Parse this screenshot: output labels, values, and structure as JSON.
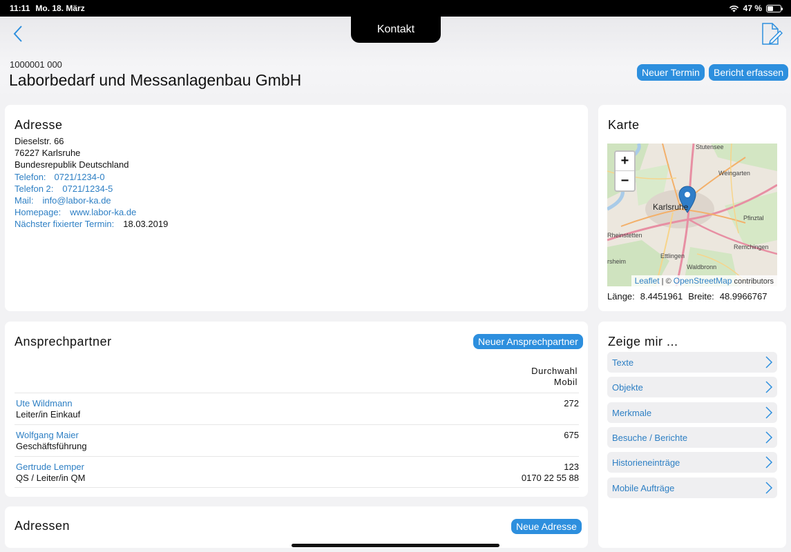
{
  "status": {
    "time": "11:11",
    "date": "Mo. 18. März",
    "battery": "47 %",
    "battery_level": 0.47
  },
  "header": {
    "title": "Kontakt",
    "customer_number": "1000001 000",
    "company_name": "Laborbedarf und Messanlagenbau GmbH",
    "btn_new_appointment": "Neuer Termin",
    "btn_create_report": "Bericht erfassen"
  },
  "address": {
    "title": "Adresse",
    "street": "Dieselstr. 66",
    "city": "76227 Karlsruhe",
    "country": "Bundesrepublik Deutschland",
    "phone_label": "Telefon:",
    "phone": "0721/1234-0",
    "phone2_label": "Telefon 2:",
    "phone2": "0721/1234-5",
    "mail_label": "Mail:",
    "mail": "info@labor-ka.de",
    "homepage_label": "Homepage:",
    "homepage": "www.labor-ka.de",
    "next_appt_label": "Nächster fixierter Termin:",
    "next_appt": "18.03.2019"
  },
  "map": {
    "title": "Karte",
    "zoom_in": "+",
    "zoom_out": "−",
    "attr_leaflet": "Leaflet",
    "attr_sep": " | © ",
    "attr_osm": "OpenStreetMap",
    "attr_contrib": " contributors",
    "places": {
      "stutensee": "Stutensee",
      "weingarten": "Weingarten",
      "karlsruhe": "Karlsruhe",
      "pfinztal": "Pfinztal",
      "rheinstetten": "Rheinstetten",
      "remchingen": "Remchingen",
      "ettlingen": "Ettlingen",
      "ersheim": "rsheim",
      "waldbronn": "Waldbronn"
    },
    "lon_label": "Länge:",
    "lon": "8.4451961",
    "lat_label": "Breite:",
    "lat": "48.9966767"
  },
  "contacts": {
    "title": "Ansprechpartner",
    "btn_new": "Neuer Ansprechpartner",
    "col1": "Durchwahl",
    "col2": "Mobil",
    "rows": [
      {
        "name": "Ute Wildmann",
        "role": "Leiter/in Einkauf",
        "ext": "272",
        "mobile": ""
      },
      {
        "name": "Wolfgang Maier",
        "role": "Geschäftsführung",
        "ext": "675",
        "mobile": ""
      },
      {
        "name": "Gertrude Lemper",
        "role": "QS / Leiter/in QM",
        "ext": "123",
        "mobile": "0170 22 55 88"
      }
    ]
  },
  "addresses": {
    "title": "Adressen",
    "btn_new": "Neue Adresse"
  },
  "show": {
    "title": "Zeige mir ...",
    "items": [
      "Texte",
      "Objekte",
      "Merkmale",
      "Besuche / Berichte",
      "Historieneinträge",
      "Mobile Aufträge"
    ]
  }
}
